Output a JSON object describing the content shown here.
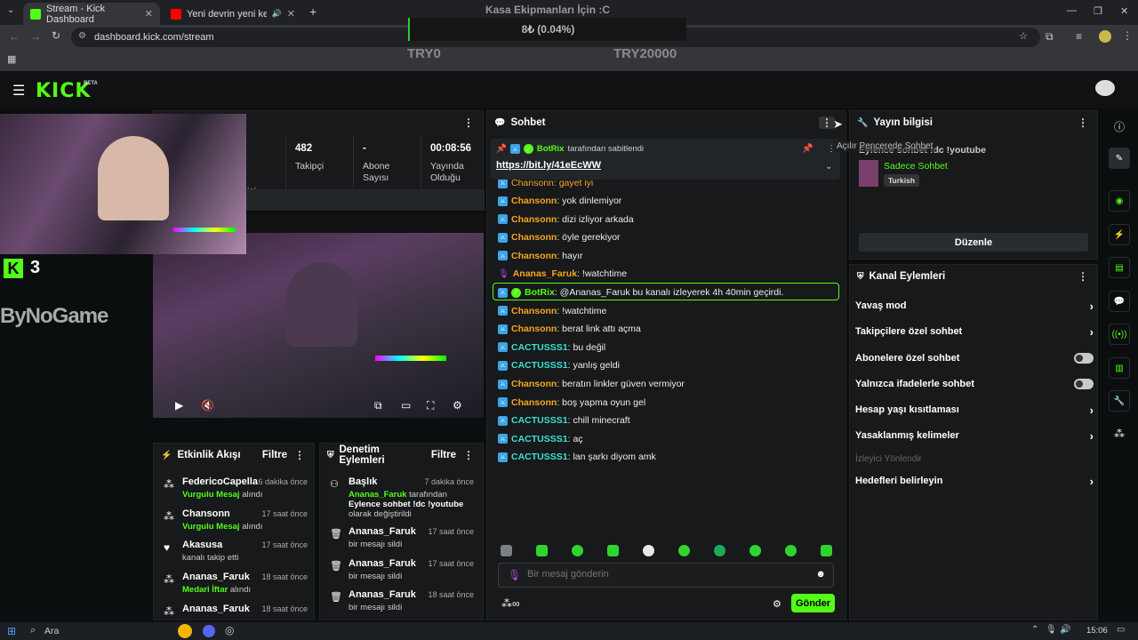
{
  "browser": {
    "tabs": [
      {
        "title": "Stream - Kick Dashboard",
        "color": "#53fc18"
      },
      {
        "title": "Yeni devrin yeni kefilleri - Yo",
        "color": "#ff0000"
      }
    ],
    "url": "dashboard.kick.com/stream"
  },
  "overlay": {
    "title": "Kasa Ekipmanları İçin :C",
    "progress": "8₺ (0.04%)",
    "min": "TRY0",
    "max": "TRY20000"
  },
  "webcam": {
    "kick_number": "3",
    "sponsor": "ByNoGame"
  },
  "stats": [
    {
      "value": "482",
      "label": "Takipçi"
    },
    {
      "value": "-",
      "label": "Abone Sayısı"
    },
    {
      "value": "00:08:56",
      "label": "Yayında Olduğu"
    }
  ],
  "stats_partial_label": "ici",
  "chat": {
    "title": "Sohbet",
    "tooltip": "Açılır Pencerede Sohbet",
    "pinned": {
      "by": "BotRix",
      "by_suffix": "tarafından sabitlendi",
      "link": "https://bit.ly/41eEcWW"
    },
    "cut_line": "Chansonn: gayet iyi",
    "messages": [
      {
        "user": "Chansonn",
        "text": ": yok dinlemiyor",
        "color": "#f5a623"
      },
      {
        "user": "Chansonn",
        "text": ": dizi izliyor arkada",
        "color": "#f5a623"
      },
      {
        "user": "Chansonn",
        "text": ": öyle gerekiyor",
        "color": "#f5a623"
      },
      {
        "user": "Chansonn",
        "text": ": hayır",
        "color": "#f5a623"
      },
      {
        "user": "Ananas_Faruk",
        "text": ": !watchtime",
        "color": "#f5a623"
      },
      {
        "user": "BotRix",
        "text": ": @Ananas_Faruk bu kanalı izleyerek 4h 40min geçirdi.",
        "color": "#53fc18"
      },
      {
        "user": "Chansonn",
        "text": ": !watchtime",
        "color": "#f5a623"
      },
      {
        "user": "Chansonn",
        "text": ": berat link attı açma",
        "color": "#f5a623"
      },
      {
        "user": "CACTUSSS1",
        "text": ": bu değil",
        "color": "#3fe0d0"
      },
      {
        "user": "CACTUSSS1",
        "text": ": yanlış geldi",
        "color": "#3fe0d0"
      },
      {
        "user": "Chansonn",
        "text": ": beratın linkler güven vermiyor",
        "color": "#f5a623"
      },
      {
        "user": "Chansonn",
        "text": ": boş yapma oyun gel",
        "color": "#f5a623"
      },
      {
        "user": "CACTUSSS1",
        "text": ": chill minecraft",
        "color": "#3fe0d0"
      },
      {
        "user": "CACTUSSS1",
        "text": ": aç",
        "color": "#3fe0d0"
      },
      {
        "user": "CACTUSSS1",
        "text": ": lan şarkı diyom amk",
        "color": "#3fe0d0"
      }
    ],
    "placeholder": "Bir mesaj gönderin",
    "send": "Gönder"
  },
  "activity": {
    "title": "Etkinlik Akışı",
    "filter": "Filtre",
    "items": [
      {
        "name": "FedericoCapella",
        "time": "6 dakika önce",
        "highlight": "Vurgulu Mesaj",
        "rest": " alındı"
      },
      {
        "name": "Chansonn",
        "time": "17 saat önce",
        "highlight": "Vurgulu Mesaj",
        "rest": " alındı"
      },
      {
        "name": "Akasusa",
        "time": "17 saat önce",
        "highlight": "",
        "rest": "kanalı takip etti"
      },
      {
        "name": "Ananas_Faruk",
        "time": "18 saat önce",
        "highlight": "Medari İftar",
        "rest": " alındı"
      },
      {
        "name": "Ananas_Faruk",
        "time": "18 saat önce",
        "highlight": "",
        "rest": ""
      }
    ]
  },
  "moderation": {
    "title": "Denetim Eylemleri",
    "filter": "Filtre",
    "items": [
      {
        "name": "Başlık",
        "time": "7 dakika önce",
        "line1a": "Ananas_Faruk",
        "line1b": " tarafından ",
        "line1c": "Eylence sohbet !dc !youtube",
        "line1d": " olarak değiştirildi"
      },
      {
        "name": "Ananas_Faruk",
        "time": "17 saat önce",
        "text": "bir mesajı sildi"
      },
      {
        "name": "Ananas_Faruk",
        "time": "17 saat önce",
        "text": "bir mesajı sildi"
      },
      {
        "name": "Ananas_Faruk",
        "time": "18 saat önce",
        "text": "bir mesajı sildi"
      }
    ]
  },
  "stream_info": {
    "title": "Yayın bilgisi",
    "stream_title": "Eylence sohbet !dc !youtube",
    "category": "Sadece Sohbet",
    "language": "Turkish",
    "edit": "Düzenle"
  },
  "channel_actions": {
    "title": "Kanal Eylemleri",
    "items": [
      {
        "label": "Yavaş mod",
        "kind": "arrow"
      },
      {
        "label": "Takipçilere özel sohbet",
        "kind": "arrow"
      },
      {
        "label": "Abonelere özel sohbet",
        "kind": "toggle"
      },
      {
        "label": "Yalnızca ifadelerle sohbet",
        "kind": "toggle"
      },
      {
        "label": "Hesap yaşı kısıtlaması",
        "kind": "arrow"
      },
      {
        "label": "Yasaklanmış kelimeler",
        "kind": "arrow"
      }
    ],
    "section_label": "İzleyici Yönlendir",
    "goals": "Hedefleri belirleyin"
  },
  "taskbar": {
    "search": "Ara",
    "time": "15:06"
  }
}
